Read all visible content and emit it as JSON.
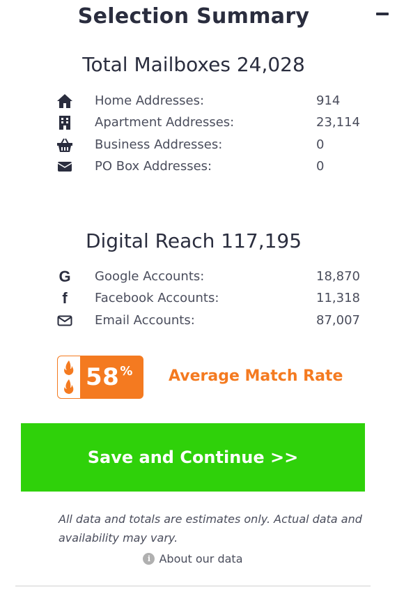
{
  "header": {
    "title": "Selection Summary",
    "collapse_icon": "minus-icon"
  },
  "mailboxes": {
    "heading": "Total Mailboxes 24,028",
    "items": [
      {
        "icon": "home-icon",
        "label": "Home Addresses:",
        "value": "914"
      },
      {
        "icon": "building-icon",
        "label": "Apartment Addresses:",
        "value": "23,114"
      },
      {
        "icon": "basket-icon",
        "label": "Business Addresses:",
        "value": "0"
      },
      {
        "icon": "envelope-icon",
        "label": "PO Box Addresses:",
        "value": "0"
      }
    ]
  },
  "digital": {
    "heading": "Digital Reach 117,195",
    "items": [
      {
        "icon": "google-icon",
        "label": "Google Accounts:",
        "value": "18,870"
      },
      {
        "icon": "facebook-icon",
        "label": "Facebook Accounts:",
        "value": "11,318"
      },
      {
        "icon": "envelope-outline-icon",
        "label": "Email Accounts:",
        "value": "87,007"
      }
    ]
  },
  "match": {
    "percent": "58",
    "percent_sign": "%",
    "label": "Average Match Rate",
    "icon": "flame-icon"
  },
  "actions": {
    "save_label": "Save and Continue >>"
  },
  "footer": {
    "disclaimer": "All data and totals are estimates only. Actual data and availability may vary.",
    "about_label": "About our data",
    "about_icon": "info-icon"
  },
  "colors": {
    "accent_orange": "#f47a20",
    "button_green": "#2fd10a",
    "text_dark": "#2a2d3e"
  }
}
